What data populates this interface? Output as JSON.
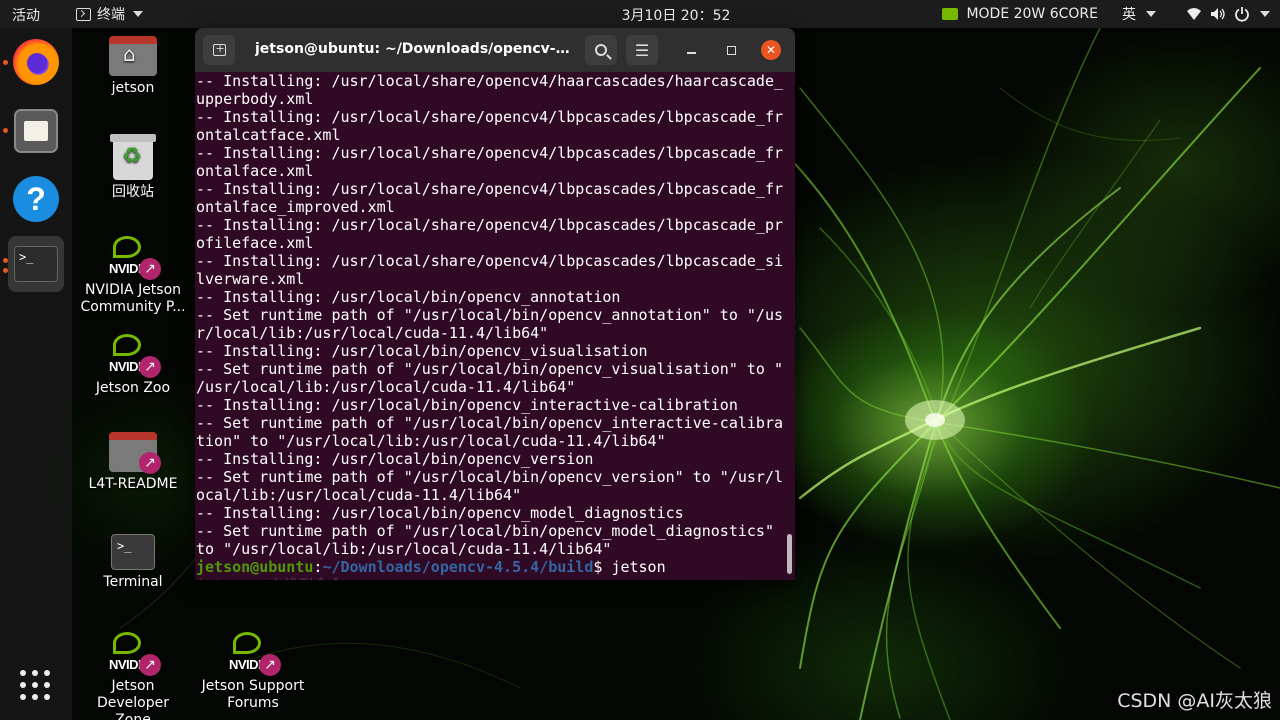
{
  "topbar": {
    "activities": "活动",
    "app_menu": "终端",
    "clock": "3月10日  20：52",
    "power_mode": "MODE 20W 6CORE",
    "ime": "英"
  },
  "dock": {
    "items": [
      {
        "name": "firefox"
      },
      {
        "name": "files"
      },
      {
        "name": "help"
      },
      {
        "name": "terminal",
        "glyph": ">_"
      }
    ]
  },
  "desktop": {
    "icons": [
      {
        "label": "jetson"
      },
      {
        "label": "回收站"
      },
      {
        "label": "NVIDIA Jetson Community P..."
      },
      {
        "label": "Jetson Zoo"
      },
      {
        "label": "L4T-README"
      },
      {
        "label": "Terminal",
        "glyph": ">_"
      },
      {
        "label": "Jetson Developer Zone"
      },
      {
        "label": "Jetson Support Forums"
      }
    ]
  },
  "terminal": {
    "title": "jetson@ubuntu: ~/Downloads/opencv-4.5...",
    "lines": [
      "-- Installing: /usr/local/share/opencv4/haarcascades/haarcascade_",
      "upperbody.xml",
      "-- Installing: /usr/local/share/opencv4/lbpcascades/lbpcascade_fr",
      "ontalcatface.xml",
      "-- Installing: /usr/local/share/opencv4/lbpcascades/lbpcascade_fr",
      "ontalface.xml",
      "-- Installing: /usr/local/share/opencv4/lbpcascades/lbpcascade_fr",
      "ontalface_improved.xml",
      "-- Installing: /usr/local/share/opencv4/lbpcascades/lbpcascade_pr",
      "ofileface.xml",
      "-- Installing: /usr/local/share/opencv4/lbpcascades/lbpcascade_si",
      "lverware.xml",
      "-- Installing: /usr/local/bin/opencv_annotation",
      "-- Set runtime path of \"/usr/local/bin/opencv_annotation\" to \"/us",
      "r/local/lib:/usr/local/cuda-11.4/lib64\"",
      "-- Installing: /usr/local/bin/opencv_visualisation",
      "-- Set runtime path of \"/usr/local/bin/opencv_visualisation\" to \"",
      "/usr/local/lib:/usr/local/cuda-11.4/lib64\"",
      "-- Installing: /usr/local/bin/opencv_interactive-calibration",
      "-- Set runtime path of \"/usr/local/bin/opencv_interactive-calibra",
      "tion\" to \"/usr/local/lib:/usr/local/cuda-11.4/lib64\"",
      "-- Installing: /usr/local/bin/opencv_version",
      "-- Set runtime path of \"/usr/local/bin/opencv_version\" to \"/usr/l",
      "ocal/lib:/usr/local/cuda-11.4/lib64\"",
      "-- Installing: /usr/local/bin/opencv_model_diagnostics",
      "-- Set runtime path of \"/usr/local/bin/opencv_model_diagnostics\"",
      "to \"/usr/local/lib:/usr/local/cuda-11.4/lib64\""
    ],
    "prompt_user": "jetson@ubuntu",
    "prompt_sep": ":",
    "prompt_path": "~/Downloads/opencv-4.5.4/build",
    "prompt_symbol": "$ ",
    "command": "jetson",
    "ghost_text": "jetson: 未找到命令"
  },
  "watermark": "CSDN @AI灰太狼"
}
